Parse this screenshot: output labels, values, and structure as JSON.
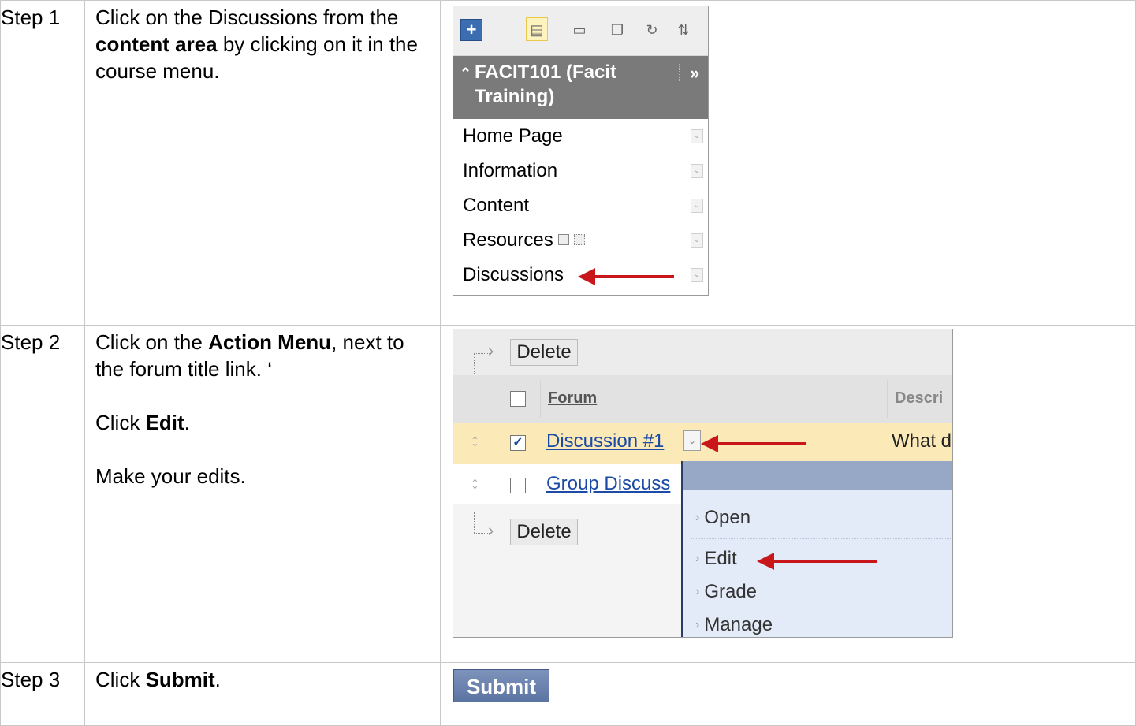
{
  "steps": [
    {
      "label": "Step 1",
      "text_before": "Click on the Discussions from the ",
      "text_bold": "content area",
      "text_after": " by clicking on it in the course menu."
    },
    {
      "label": "Step 2",
      "line1_before": "Click on the ",
      "line1_bold": "Action Menu",
      "line1_after": ", next to the forum title link. ‘",
      "line2_before": "Click ",
      "line2_bold": "Edit",
      "line2_after": ".",
      "line3": "Make your edits."
    },
    {
      "label": "Step 3",
      "text_before": "Click ",
      "text_bold": "Submit",
      "text_after": "."
    }
  ],
  "course_menu": {
    "course_title": "FACIT101 (Facit Training)",
    "items": [
      "Home Page",
      "Information",
      "Content",
      "Resources",
      "Discussions"
    ],
    "accent": "#3c6db0"
  },
  "forum_screen": {
    "delete_label": "Delete",
    "col_forum": "Forum",
    "col_description": "Descri",
    "rows": [
      {
        "title": "Discussion #1",
        "description": "What d",
        "checked": true
      },
      {
        "title": "Group Discuss",
        "description": "",
        "checked": false
      }
    ],
    "action_menu": [
      "Open",
      "Edit",
      "Grade",
      "Manage"
    ]
  },
  "submit_label": "Submit",
  "colors": {
    "arrow": "#c8161b",
    "submit": "#5c74a2",
    "highlight_row": "#fce9b8"
  }
}
